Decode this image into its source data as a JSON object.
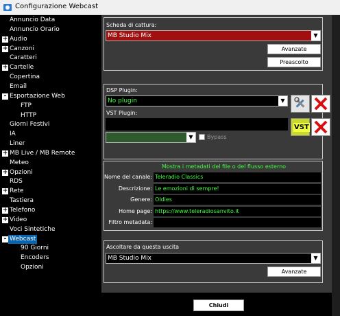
{
  "window": {
    "title": "Configurazione Webcast"
  },
  "tree": {
    "items": [
      {
        "label": "Annuncio Data",
        "expander": "",
        "level": 0
      },
      {
        "label": "Annuncio Orario",
        "expander": "",
        "level": 0
      },
      {
        "label": "Audio",
        "expander": "+",
        "level": 0
      },
      {
        "label": "Canzoni",
        "expander": "+",
        "level": 0
      },
      {
        "label": "Caratteri",
        "expander": "",
        "level": 0
      },
      {
        "label": "Cartelle",
        "expander": "+",
        "level": 0
      },
      {
        "label": "Copertina",
        "expander": "",
        "level": 0
      },
      {
        "label": "Email",
        "expander": "",
        "level": 0
      },
      {
        "label": "Esportazione Web",
        "expander": "-",
        "level": 0
      },
      {
        "label": "FTP",
        "expander": "",
        "level": 1
      },
      {
        "label": "HTTP",
        "expander": "",
        "level": 1
      },
      {
        "label": "Giorni Festivi",
        "expander": "",
        "level": 0
      },
      {
        "label": "IA",
        "expander": "",
        "level": 0
      },
      {
        "label": "Liner",
        "expander": "",
        "level": 0
      },
      {
        "label": "MB Live / MB Remote",
        "expander": "+",
        "level": 0
      },
      {
        "label": "Meteo",
        "expander": "",
        "level": 0
      },
      {
        "label": "Opzioni",
        "expander": "+",
        "level": 0
      },
      {
        "label": "RDS",
        "expander": "",
        "level": 0
      },
      {
        "label": "Rete",
        "expander": "+",
        "level": 0
      },
      {
        "label": "Tastiera",
        "expander": "",
        "level": 0
      },
      {
        "label": "Telefono",
        "expander": "+",
        "level": 0
      },
      {
        "label": "Video",
        "expander": "+",
        "level": 0
      },
      {
        "label": "Voci Sintetiche",
        "expander": "",
        "level": 0
      },
      {
        "label": "Webcast",
        "expander": "-",
        "level": 0,
        "selected": true
      },
      {
        "label": "90 Giorni",
        "expander": "",
        "level": 1
      },
      {
        "label": "Encoders",
        "expander": "",
        "level": 1
      },
      {
        "label": "Opzioni",
        "expander": "",
        "level": 1
      }
    ]
  },
  "capture": {
    "label": "Scheda di cattura:",
    "value": "MB Studio Mix",
    "advanced_btn": "Avanzate",
    "prelisten_btn": "Preascolto",
    "color": "#a01010"
  },
  "plugins": {
    "dsp_label": "DSP Plugin:",
    "dsp_value": "No plugin",
    "vst_label": "VST Plugin:",
    "vst_icon_text": "VST",
    "bypass_label": "Bypass"
  },
  "metadata": {
    "heading": "Mostra i metadati del file o del flusso esterno",
    "fields": [
      {
        "label": "Nome del canale:",
        "value": "Teleradio Classics"
      },
      {
        "label": "Descrizione:",
        "value": "Le emozioni di sempre!"
      },
      {
        "label": "Genere:",
        "value": "Oldies"
      },
      {
        "label": "Home page:",
        "value": "https://www.teleradiosanvito.it"
      },
      {
        "label": "Filtro metadata:",
        "value": ""
      }
    ]
  },
  "output": {
    "label": "Ascoltare da questa uscita",
    "value": "MB Studio Mix",
    "advanced_btn": "Avanzate"
  },
  "footer": {
    "close_btn": "Chiudi"
  }
}
